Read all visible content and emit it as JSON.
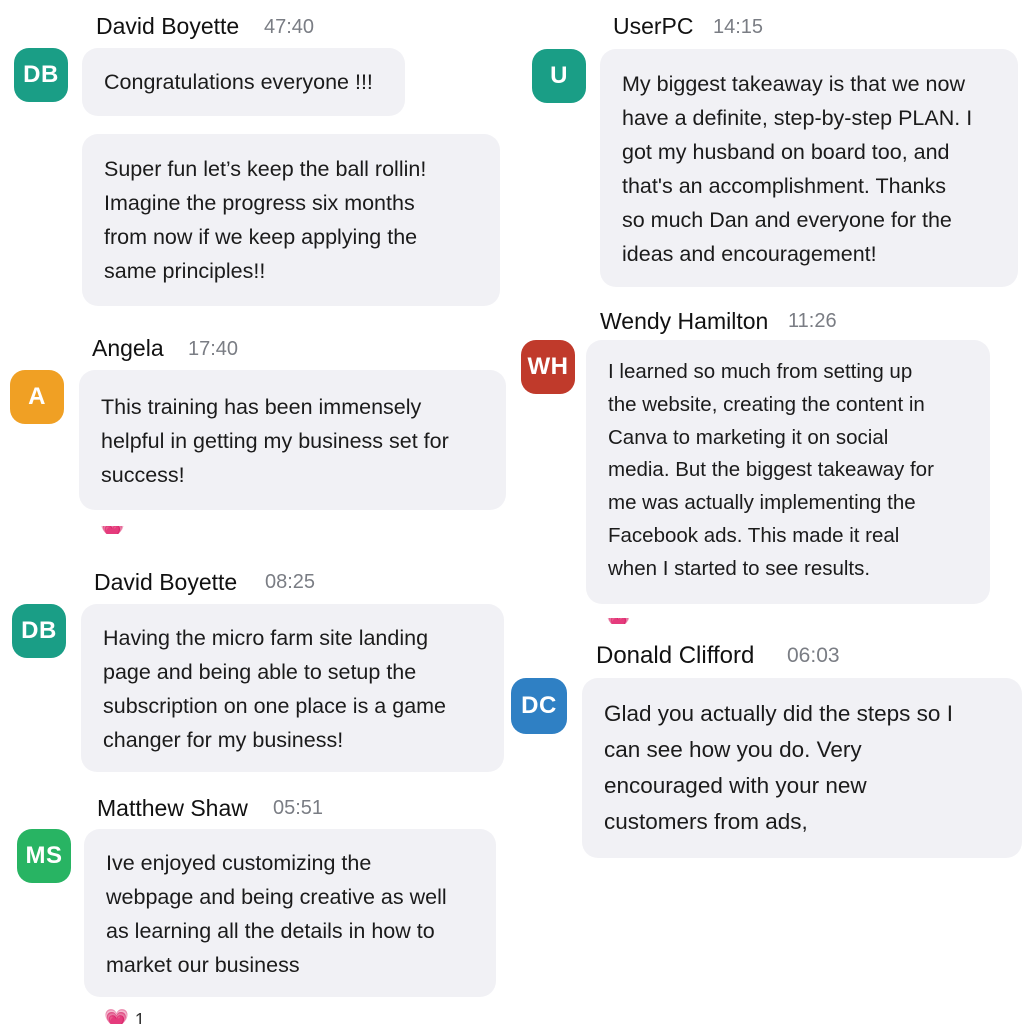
{
  "colors": {
    "avatar_db": "#1a9e86",
    "avatar_u": "#1a9e86",
    "avatar_a": "#f0a024",
    "avatar_wh": "#c03a2b",
    "avatar_dc": "#2f80c4",
    "avatar_ms": "#28b463",
    "bubble_bg": "#f1f1f5",
    "timestamp": "#7a7d84",
    "heart": "#e86aa0"
  },
  "messages": [
    {
      "author": "David Boyette",
      "initials": "DB",
      "time": "47:40",
      "texts": [
        "Congratulations everyone !!!",
        "Super fun let’s keep the ball rollin!\nImagine the progress six months\nfrom now if we keep applying the\nsame principles!!"
      ]
    },
    {
      "author": "Angela",
      "initials": "A",
      "time": "17:40",
      "texts": [
        "This training has been immensely\nhelpful in getting my business set for\nsuccess!"
      ]
    },
    {
      "author": "David Boyette",
      "initials": "DB",
      "time": "08:25",
      "texts": [
        "Having the micro farm site landing\npage and being able to setup the\nsubscription on one place is a game\nchanger for my business!"
      ]
    },
    {
      "author": "Matthew Shaw",
      "initials": "MS",
      "time": "05:51",
      "texts": [
        "Ive enjoyed customizing the\nwebpage and being creative as well\nas learning all the details in how to\nmarket our business"
      ],
      "reaction": {
        "icon": "heart-icon",
        "count": "1"
      }
    },
    {
      "author": "UserPC",
      "initials": "U",
      "time": "14:15",
      "texts": [
        "My biggest takeaway is that we now\nhave a definite, step-by-step PLAN.  I\ngot my husband on board too, and\nthat's an accomplishment.   Thanks\nso much Dan and everyone for the\nideas and encouragement!"
      ]
    },
    {
      "author": "Wendy Hamilton",
      "initials": "WH",
      "time": "11:26",
      "texts": [
        "I learned so much from setting up\nthe website, creating the content in\nCanva to marketing it on social\nmedia. But the biggest takeaway for\nme was actually implementing the\nFacebook ads. This made it real\nwhen I started to see results."
      ]
    },
    {
      "author": "Donald Clifford",
      "initials": "DC",
      "time": "06:03",
      "texts": [
        "Glad you actually did the steps so I\ncan see how you do. Very\nencouraged with your new\ncustomers from ads,"
      ]
    }
  ]
}
